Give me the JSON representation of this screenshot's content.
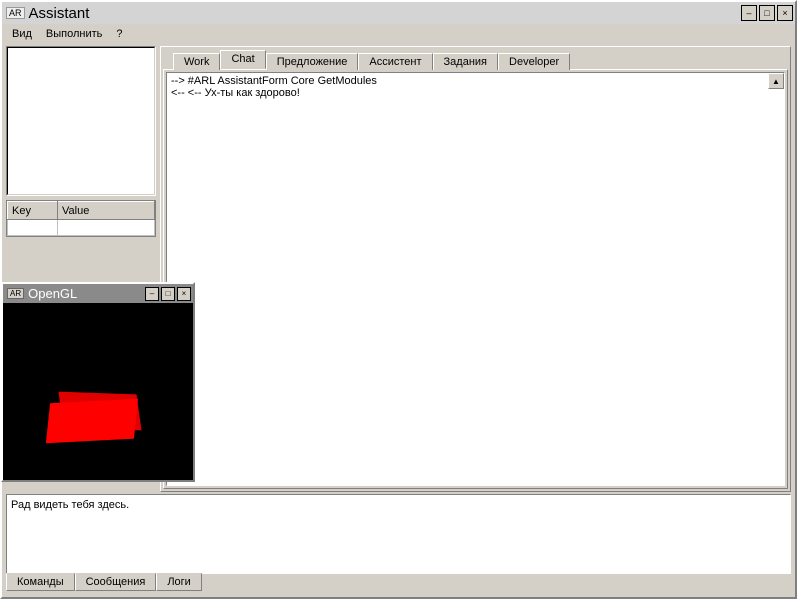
{
  "main_window": {
    "badge": "AR",
    "title": "Assistant"
  },
  "menubar": {
    "items": [
      "Вид",
      "Выполнить",
      "?"
    ]
  },
  "kv_table": {
    "headers": {
      "key": "Key",
      "value": "Value"
    }
  },
  "tabs": {
    "items": [
      "Work",
      "Chat",
      "Предложение",
      "Ассистент",
      "Задания",
      "Developer"
    ],
    "active_index": 1
  },
  "chat_log": {
    "lines": [
      "--> #ARL AssistantForm Core GetModules",
      "<-- <-- Ух-ты как здорово!"
    ]
  },
  "bottom": {
    "message": "Рад видеть тебя здесь.",
    "tabs": [
      "Команды",
      "Сообщения",
      "Логи"
    ],
    "active_index": 1
  },
  "gl_window": {
    "badge": "AR",
    "title": "OpenGL"
  }
}
